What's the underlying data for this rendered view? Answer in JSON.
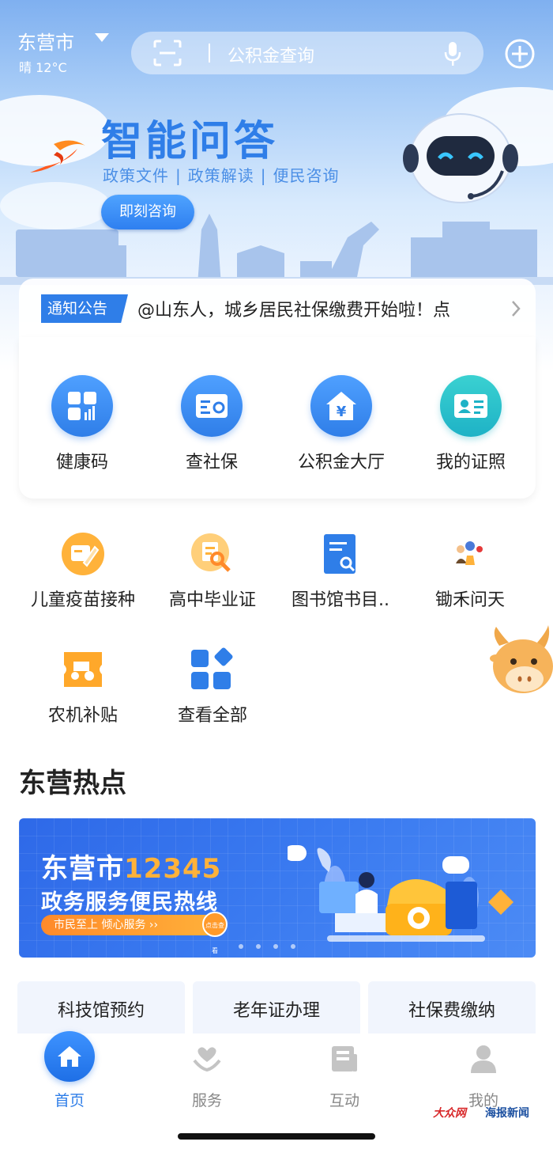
{
  "header": {
    "city": "东营市",
    "weather": "晴 12°C",
    "search_placeholder": "公积金查询"
  },
  "hero": {
    "title": "智能问答",
    "subtitle_items": [
      "政策文件",
      "政策解读",
      "便民咨询"
    ],
    "subtitle_sep": "|",
    "consult_label": "即刻咨询"
  },
  "notice": {
    "tag": "通知公告",
    "text": "@山东人，城乡居民社保缴费开始啦！点"
  },
  "main_services": [
    {
      "label": "健康码",
      "icon": "grid-chart-icon"
    },
    {
      "label": "查社保",
      "icon": "card-eye-icon"
    },
    {
      "label": "公积金大厅",
      "icon": "house-yen-icon"
    },
    {
      "label": "我的证照",
      "icon": "id-card-icon"
    }
  ],
  "small_services": [
    {
      "label": "儿童疫苗接种",
      "icon": "vaccine-icon"
    },
    {
      "label": "高中毕业证",
      "icon": "certificate-search-icon"
    },
    {
      "label": "图书馆书目..",
      "icon": "book-search-icon"
    },
    {
      "label": "锄禾问天",
      "icon": "farm-people-icon"
    },
    {
      "label": "农机补贴",
      "icon": "tractor-ticket-icon"
    },
    {
      "label": "查看全部",
      "icon": "all-apps-icon"
    }
  ],
  "hot": {
    "title": "东营热点",
    "banner": {
      "line1_prefix": "东营市",
      "line1_num": "12345",
      "line2": "政务服务便民热线",
      "pill": "市民至上  倾心服务  ››",
      "click": "点击查看"
    }
  },
  "chips": [
    "科技馆预约",
    "老年证办理",
    "社保费缴纳"
  ],
  "tabs": [
    {
      "label": "首页",
      "icon": "home-icon",
      "active": true
    },
    {
      "label": "服务",
      "icon": "service-hand-icon",
      "active": false
    },
    {
      "label": "互动",
      "icon": "interact-icon",
      "active": false
    },
    {
      "label": "我的",
      "icon": "user-icon",
      "active": false
    }
  ],
  "watermark": {
    "left": "大众网",
    "right": "海报新闻"
  },
  "colors": {
    "primary": "#2f7ee8",
    "teal": "#1eb2c6",
    "orange": "#ffb23a"
  }
}
